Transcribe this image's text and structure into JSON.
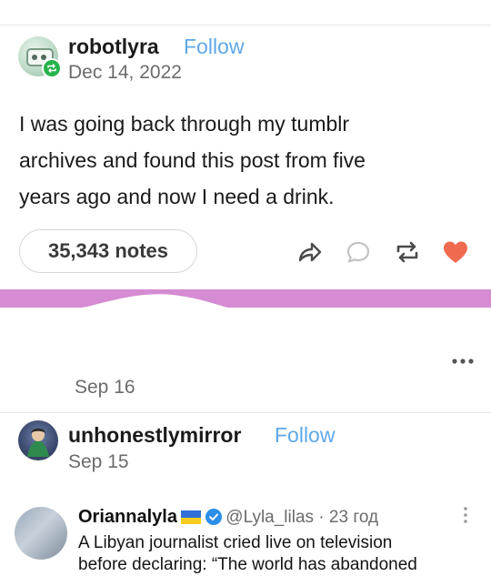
{
  "post1": {
    "username": "robotlyra",
    "follow_label": "Follow",
    "date": "Dec 14, 2022",
    "body_lines": [
      "I was going back through my tumblr",
      "archives and found this post from five",
      "years ago and now I need a drink."
    ],
    "notes": "35,343 notes"
  },
  "post2": {
    "date": "Sep 16"
  },
  "post3": {
    "username": "unhonestlymirror",
    "follow_label": "Follow",
    "date": "Sep 15"
  },
  "embedded_tweet": {
    "name": "Oriannalyla",
    "handle_time": "@Lyla_lilas · 23 год",
    "text_lines": [
      "A Libyan journalist cried live on television",
      "before declaring: “The world has abandoned"
    ]
  },
  "colors": {
    "follow": "#5fa8e8",
    "like_heart": "#f06a4f",
    "pink_bar": "#d58cd2",
    "reblog_badge": "#26b34b"
  },
  "icons": [
    "share-icon",
    "reply-icon",
    "reblog-icon",
    "like-icon",
    "more-options-icon",
    "reblog-badge-icon"
  ]
}
